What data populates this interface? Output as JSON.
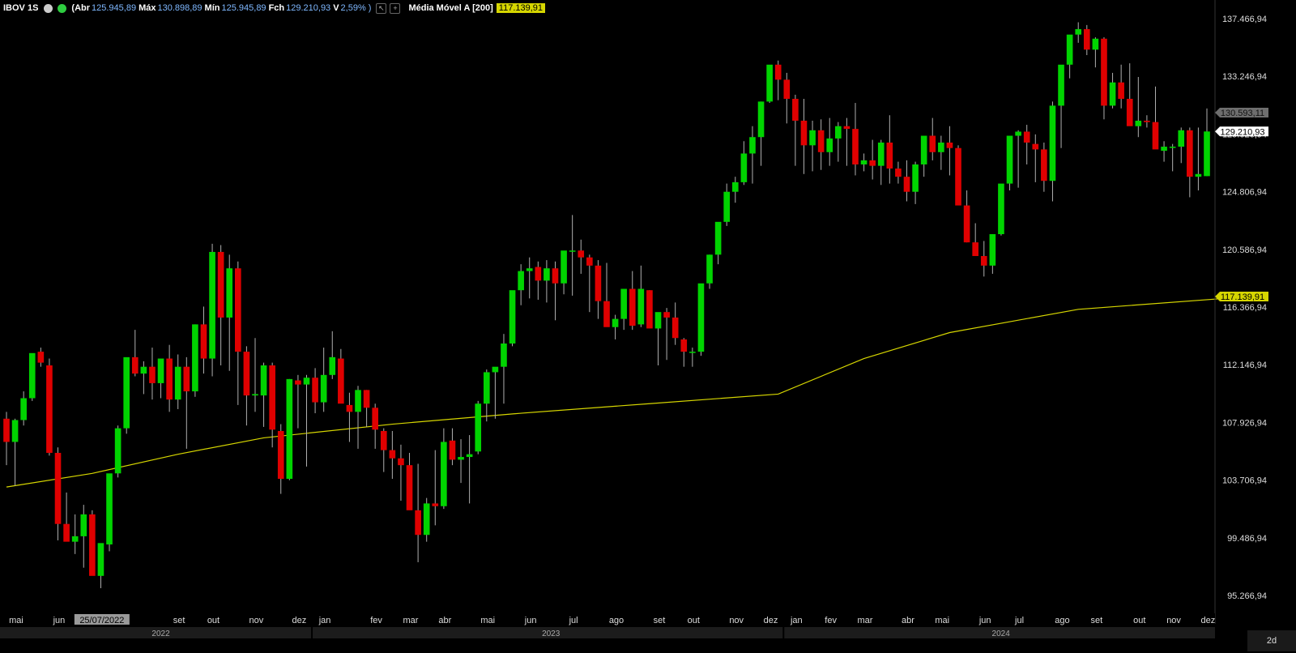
{
  "header": {
    "symbol": "IBOV 1S",
    "open_label": "(Abr",
    "open_value": "125.945,89",
    "high_label": "Máx",
    "high_value": "130.898,89",
    "low_label": "Mín",
    "low_value": "125.945,89",
    "close_label": "Fch",
    "close_value": "129.210,93",
    "change_label": "V",
    "change_value": "2,59% )",
    "ma_label": "Média Móvel A [200]",
    "ma_value": "117.139,91"
  },
  "period_button": "2d",
  "colors": {
    "up": "#00d400",
    "down": "#e00000",
    "ma": "#d6d600",
    "background": "#000000"
  },
  "chart_data": {
    "type": "candlestick",
    "title": "IBOV 1S",
    "y_ticks": [
      95266.94,
      99486.94,
      103706.94,
      107926.94,
      112146.94,
      116366.94,
      120586.94,
      124806.94,
      129026.94,
      133246.94,
      137466.94
    ],
    "y_tick_labels": [
      "95.266,94",
      "99.486,94",
      "103.706,94",
      "107.926,94",
      "112.146,94",
      "116.366,94",
      "120.586,94",
      "124.806,94",
      "129.026,94",
      "133.246,94",
      "137.466,94"
    ],
    "ylim": [
      94500,
      138500
    ],
    "month_labels": [
      "mai",
      "jun",
      "25/07/2022",
      "set",
      "out",
      "nov",
      "dez",
      "jan",
      "fev",
      "mar",
      "abr",
      "mai",
      "jun",
      "jul",
      "ago",
      "set",
      "out",
      "nov",
      "dez",
      "jan",
      "fev",
      "mar",
      "abr",
      "mai",
      "jun",
      "jul",
      "ago",
      "set",
      "out",
      "nov",
      "dez"
    ],
    "month_start_index": [
      0,
      5,
      10,
      19,
      23,
      28,
      33,
      36,
      42,
      46,
      50,
      55,
      60,
      65,
      70,
      75,
      79,
      84,
      88,
      91,
      95,
      99,
      104,
      108,
      113,
      117,
      122,
      126,
      131,
      135,
      139
    ],
    "year_labels": [
      "2022",
      "2023",
      "2024"
    ],
    "year_start_index": [
      0,
      36,
      91
    ],
    "moving_average": {
      "name": "Média Móvel A [200]",
      "last": 117139.91
    },
    "moving_average_points": [
      [
        0,
        103200
      ],
      [
        10,
        104200
      ],
      [
        20,
        105600
      ],
      [
        30,
        106800
      ],
      [
        45,
        107800
      ],
      [
        60,
        108600
      ],
      [
        75,
        109300
      ],
      [
        90,
        110000
      ],
      [
        100,
        112600
      ],
      [
        110,
        114500
      ],
      [
        125,
        116200
      ],
      [
        145,
        117139.91
      ]
    ],
    "last_close": 129210.93,
    "last_close_label": "129.210,93",
    "cursor_price_label": "130.593,11",
    "ma_label": "117.139,91",
    "candles": [
      [
        108200,
        108700,
        104800,
        106500
      ],
      [
        106500,
        108200,
        103300,
        108100
      ],
      [
        108100,
        110200,
        107700,
        109700
      ],
      [
        109700,
        112800,
        109500,
        113000
      ],
      [
        113100,
        113400,
        112000,
        112300
      ],
      [
        112100,
        112600,
        105500,
        105700
      ],
      [
        105700,
        106100,
        99300,
        100500
      ],
      [
        100500,
        102800,
        99700,
        99200
      ],
      [
        99200,
        101200,
        98300,
        99600
      ],
      [
        99600,
        101900,
        97300,
        101200
      ],
      [
        101200,
        101500,
        97300,
        96700
      ],
      [
        96700,
        98400,
        95800,
        99100
      ],
      [
        99000,
        103800,
        98500,
        104200
      ],
      [
        104200,
        107700,
        103900,
        107500
      ],
      [
        107500,
        112000,
        107100,
        112700
      ],
      [
        112700,
        114700,
        111300,
        111500
      ],
      [
        111500,
        112400,
        110000,
        112000
      ],
      [
        112000,
        113400,
        109600,
        110800
      ],
      [
        110800,
        112500,
        109700,
        112600
      ],
      [
        112600,
        113600,
        108700,
        109600
      ],
      [
        109600,
        112900,
        108900,
        112000
      ],
      [
        112000,
        112700,
        106000,
        110200
      ],
      [
        110200,
        115100,
        109800,
        115100
      ],
      [
        115100,
        116400,
        111500,
        112600
      ],
      [
        112600,
        121000,
        111300,
        120400
      ],
      [
        120400,
        120900,
        112100,
        115600
      ],
      [
        115600,
        120200,
        111700,
        119200
      ],
      [
        119200,
        119700,
        109200,
        113100
      ],
      [
        113100,
        113500,
        107700,
        109900
      ],
      [
        109900,
        114100,
        108700,
        110000
      ],
      [
        109900,
        112300,
        107600,
        112100
      ],
      [
        112100,
        112300,
        106100,
        107400
      ],
      [
        107300,
        107800,
        102700,
        103800
      ],
      [
        103800,
        111100,
        103700,
        111100
      ],
      [
        111000,
        111400,
        107500,
        110700
      ],
      [
        110700,
        111400,
        104700,
        111200
      ],
      [
        111200,
        111900,
        108600,
        109400
      ],
      [
        109400,
        113400,
        108700,
        111400
      ],
      [
        111400,
        114600,
        111100,
        112700
      ],
      [
        112600,
        113300,
        109500,
        109300
      ],
      [
        109200,
        110100,
        106500,
        108700
      ],
      [
        108700,
        110600,
        106000,
        110300
      ],
      [
        110300,
        110300,
        107600,
        109000
      ],
      [
        109000,
        109300,
        106000,
        107400
      ],
      [
        107300,
        107500,
        104300,
        105900
      ],
      [
        105900,
        107300,
        103800,
        105300
      ],
      [
        105300,
        106300,
        102200,
        104800
      ],
      [
        104800,
        105700,
        101700,
        101500
      ],
      [
        101500,
        104900,
        97700,
        99700
      ],
      [
        99700,
        102400,
        99200,
        102000
      ],
      [
        102000,
        105900,
        100400,
        101800
      ],
      [
        101800,
        107500,
        101600,
        106500
      ],
      [
        106600,
        107500,
        104800,
        105200
      ],
      [
        105200,
        106700,
        103500,
        105400
      ],
      [
        105400,
        107000,
        102000,
        105600
      ],
      [
        105800,
        109500,
        105600,
        109300
      ],
      [
        109300,
        111800,
        108000,
        111600
      ],
      [
        111600,
        111800,
        108200,
        112000
      ],
      [
        112000,
        114400,
        109300,
        113700
      ],
      [
        113700,
        117300,
        113500,
        117600
      ],
      [
        117600,
        119500,
        116500,
        119000
      ],
      [
        119000,
        120000,
        117000,
        119200
      ],
      [
        119300,
        119700,
        116900,
        118300
      ],
      [
        118300,
        119800,
        116700,
        119200
      ],
      [
        119200,
        119700,
        115400,
        118100
      ],
      [
        118100,
        119500,
        117300,
        120500
      ],
      [
        120500,
        123100,
        117200,
        120500
      ],
      [
        120500,
        121300,
        118800,
        120000
      ],
      [
        120000,
        120200,
        116000,
        119400
      ],
      [
        119400,
        119800,
        115500,
        116800
      ],
      [
        116800,
        119600,
        115600,
        114900
      ],
      [
        114900,
        115800,
        114000,
        115500
      ],
      [
        115500,
        117000,
        114700,
        117700
      ],
      [
        117700,
        119000,
        114700,
        115000
      ],
      [
        115100,
        119400,
        114900,
        117700
      ],
      [
        117600,
        117600,
        115200,
        114800
      ],
      [
        114800,
        115700,
        112100,
        116000
      ],
      [
        116000,
        116300,
        112500,
        115600
      ],
      [
        115600,
        116700,
        113600,
        114100
      ],
      [
        114000,
        114100,
        112000,
        113100
      ],
      [
        113100,
        113400,
        112000,
        113100
      ],
      [
        113100,
        118000,
        112800,
        118100
      ],
      [
        118100,
        120200,
        117700,
        120200
      ],
      [
        120200,
        121000,
        119500,
        122600
      ],
      [
        122600,
        125400,
        122300,
        124800
      ],
      [
        124800,
        125900,
        124000,
        125500
      ],
      [
        125500,
        128500,
        125300,
        127600
      ],
      [
        127600,
        129600,
        125400,
        128800
      ],
      [
        128800,
        131400,
        126700,
        131400
      ],
      [
        131400,
        133700,
        131300,
        134100
      ],
      [
        134100,
        134400,
        131500,
        133000
      ],
      [
        133000,
        133500,
        129800,
        131600
      ],
      [
        131600,
        131900,
        126700,
        130000
      ],
      [
        130000,
        131600,
        126100,
        128200
      ],
      [
        128200,
        130000,
        126300,
        129300
      ],
      [
        129300,
        130100,
        126400,
        127700
      ],
      [
        127700,
        130200,
        126700,
        128700
      ],
      [
        128700,
        129900,
        127000,
        129600
      ],
      [
        129600,
        130200,
        126700,
        129400
      ],
      [
        129400,
        131300,
        126000,
        126800
      ],
      [
        126800,
        127600,
        126300,
        127100
      ],
      [
        127100,
        128600,
        125700,
        126700
      ],
      [
        126700,
        128600,
        125300,
        128400
      ],
      [
        128400,
        130400,
        125400,
        126500
      ],
      [
        126500,
        127000,
        125400,
        125900
      ],
      [
        125900,
        127100,
        124100,
        124800
      ],
      [
        124800,
        127000,
        123900,
        126800
      ],
      [
        126800,
        127500,
        125900,
        128900
      ],
      [
        128900,
        130200,
        127100,
        127700
      ],
      [
        127700,
        128900,
        126400,
        128400
      ],
      [
        128400,
        129600,
        126000,
        128000
      ],
      [
        128000,
        128200,
        124500,
        123800
      ],
      [
        123800,
        124900,
        121100,
        121100
      ],
      [
        121100,
        122500,
        120100,
        120100
      ],
      [
        120100,
        121200,
        118600,
        119400
      ],
      [
        119400,
        121700,
        118800,
        121700
      ],
      [
        121700,
        124400,
        121600,
        125400
      ],
      [
        125400,
        128500,
        124900,
        128900
      ],
      [
        128900,
        129300,
        125100,
        129200
      ],
      [
        129200,
        129700,
        126800,
        128400
      ],
      [
        128300,
        129000,
        125500,
        127900
      ],
      [
        127900,
        128400,
        124800,
        125600
      ],
      [
        125600,
        131400,
        124100,
        131100
      ],
      [
        131100,
        133000,
        128000,
        134100
      ],
      [
        134100,
        135600,
        133100,
        136300
      ],
      [
        136300,
        137200,
        135700,
        136700
      ],
      [
        136700,
        137000,
        134800,
        135200
      ],
      [
        135200,
        136100,
        133900,
        136000
      ],
      [
        136000,
        136100,
        130100,
        131100
      ],
      [
        131100,
        133500,
        130900,
        132800
      ],
      [
        132800,
        134100,
        130900,
        131600
      ],
      [
        131600,
        134200,
        129800,
        129600
      ],
      [
        129600,
        133200,
        128800,
        130000
      ],
      [
        130000,
        130400,
        129500,
        129900
      ],
      [
        129900,
        132500,
        128700,
        127900
      ],
      [
        127800,
        128500,
        127000,
        128100
      ],
      [
        128100,
        128300,
        126300,
        128100
      ],
      [
        128100,
        129500,
        126900,
        129300
      ],
      [
        129300,
        129500,
        124400,
        125900
      ],
      [
        125900,
        129500,
        124900,
        126100
      ],
      [
        125945.89,
        130898.89,
        125945.89,
        129210.93
      ]
    ]
  }
}
